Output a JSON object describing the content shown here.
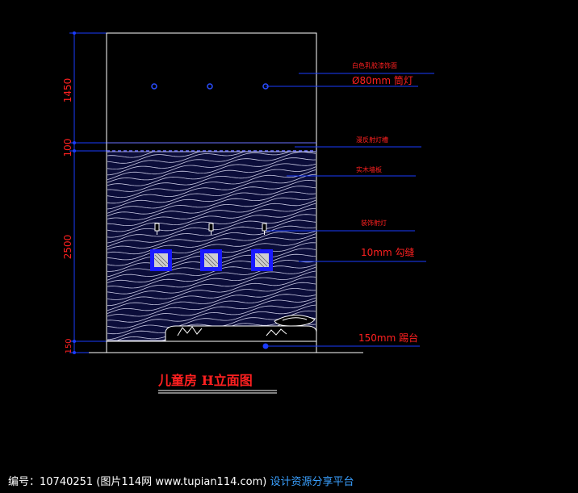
{
  "title": "儿童房 H立面图",
  "dimensions": [
    "1450",
    "100",
    "2500",
    "150"
  ],
  "callouts": [
    "白色乳胶漆饰面",
    "Ø80mm 筒灯",
    "漫反射灯槽",
    "实木墙板",
    "装饰射灯",
    "10mm 勾缝",
    "150mm 踢台"
  ],
  "footer": {
    "id_text": "编号：10740251 (图片114网 www.tupian114.com)",
    "tagline": "设计资源分享平台"
  },
  "colors": {
    "background": "#000000",
    "dimension_text": "#ff2020",
    "dimension_line": "#1a3cff",
    "outline": "#ffffff",
    "hatch": "#e8e8ff"
  }
}
